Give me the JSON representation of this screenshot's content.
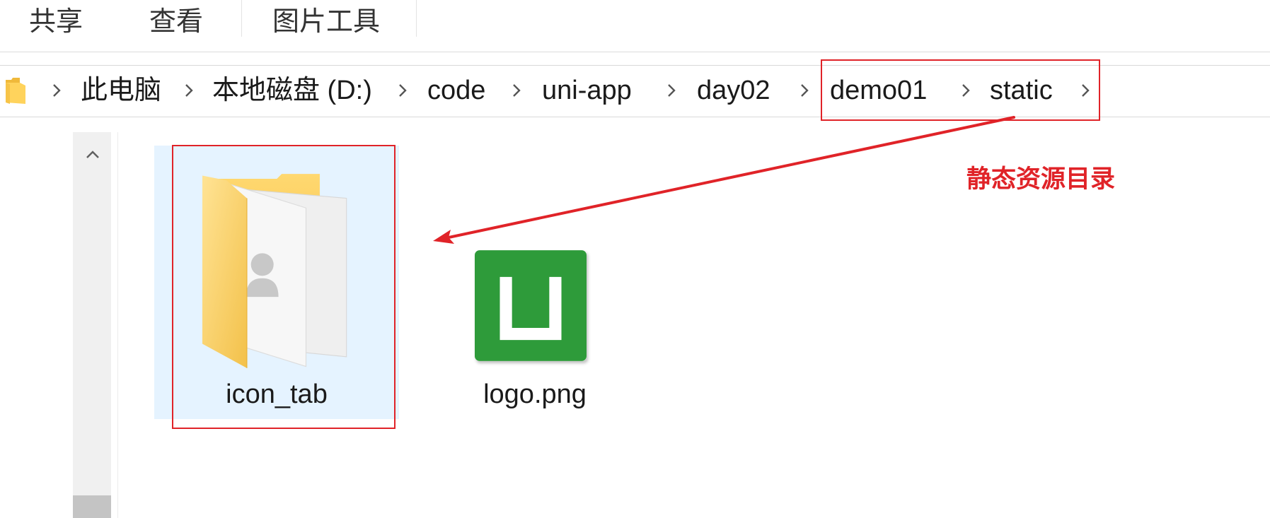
{
  "ribbon": {
    "tabs": [
      "共享",
      "查看",
      "图片工具"
    ]
  },
  "address_bar": {
    "root_icon": "folder-icon",
    "separator_icon": "chevron-right-icon",
    "crumbs": [
      {
        "label": "此电脑",
        "highlighted": false
      },
      {
        "label": "本地磁盘 (D:)",
        "highlighted": false
      },
      {
        "label": "code",
        "highlighted": false
      },
      {
        "label": "uni-app",
        "highlighted": false
      },
      {
        "label": "day02",
        "highlighted": false
      },
      {
        "label": "demo01",
        "highlighted": true
      },
      {
        "label": "static",
        "highlighted": true
      }
    ]
  },
  "scrollbar": {
    "up_icon": "chevron-up-icon"
  },
  "files": [
    {
      "name": "icon_tab",
      "icon": "folder-icon",
      "selected": true,
      "highlighted": true
    },
    {
      "name": "logo.png",
      "icon": "image-thumbnail",
      "selected": false,
      "highlighted": false
    }
  ],
  "annotation": {
    "label": "静态资源目录",
    "arrow_icon": "arrow-icon"
  },
  "colors": {
    "annotation_red": "#e02328",
    "selection_blue": "#e5f3ff",
    "logo_green": "#2e9b3a",
    "folder_yellow": "#f5c54e"
  }
}
